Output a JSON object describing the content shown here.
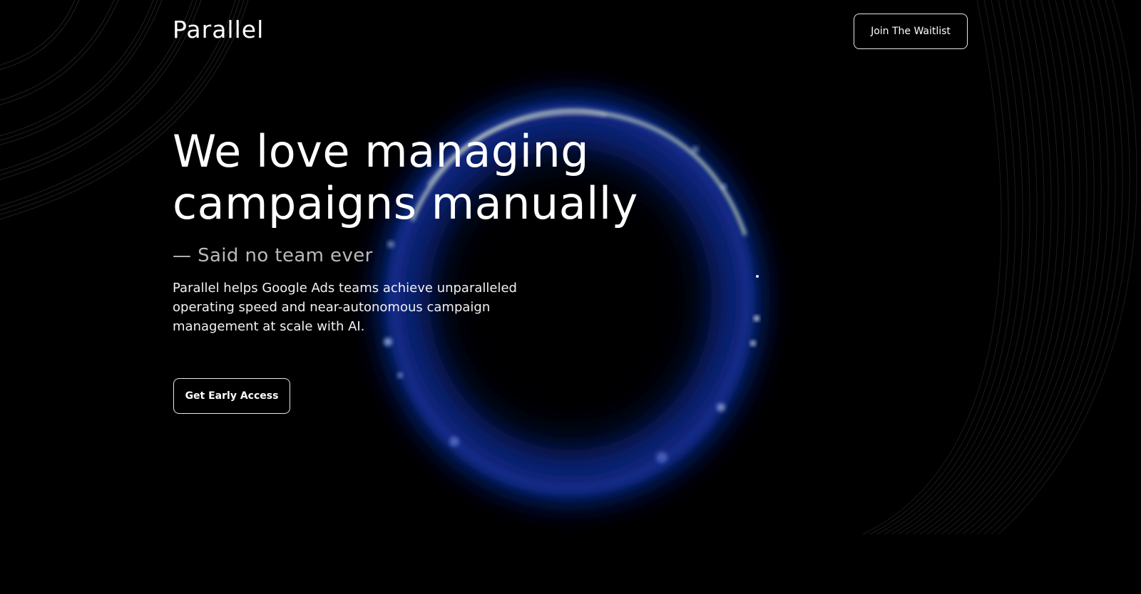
{
  "nav": {
    "logo": "Parallel",
    "waitlist_label": "Join The Waitlist"
  },
  "hero": {
    "title": "We love managing campaigns manually",
    "tagline": "— Said no team ever",
    "description": "Parallel helps Google Ads teams achieve unparalleled operating speed and near-autonomous campaign management at scale with AI.",
    "cta_label": "Get Early Access"
  },
  "theme": {
    "background": "#000000",
    "ring_glow": "#1a3fd6",
    "ring_highlight": "#d8e8c8",
    "text": "#ffffff",
    "muted_text": "#b9b9b9"
  }
}
